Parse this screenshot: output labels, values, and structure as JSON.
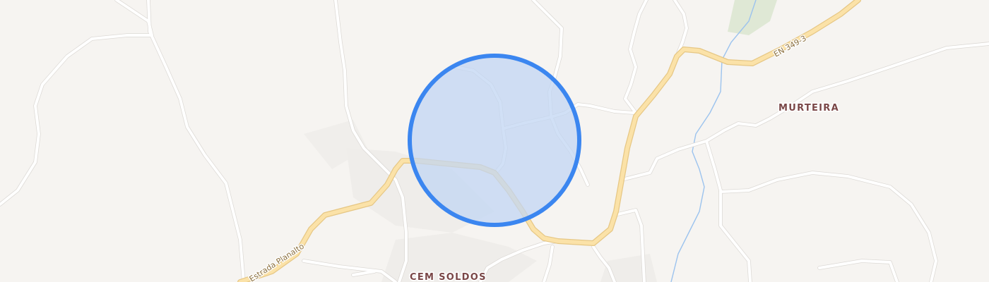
{
  "map": {
    "places": {
      "murteira": "MURTEIRA",
      "cem_soldos": "CEM SOLDOS"
    },
    "roads": {
      "en_349_3": "EN 349-3",
      "estrada_planalto": "Estrada Planalto"
    },
    "colors": {
      "background": "#f6f4f1",
      "park": "#dfe8d5",
      "major_road": "#fbe2a8",
      "minor_road": "#ffffff",
      "water": "#9cc3ee",
      "location_accent": "#3b86f0",
      "location_fill": "#c9daf3",
      "place_label": "#7a4747"
    },
    "location_marker": "accuracy-circle"
  }
}
